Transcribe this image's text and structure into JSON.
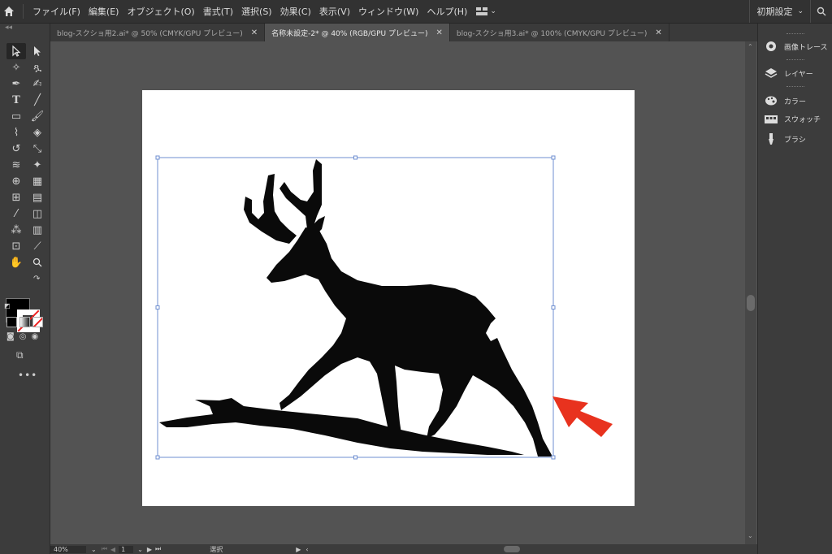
{
  "menu": {
    "items": [
      "ファイル(F)",
      "編集(E)",
      "オブジェクト(O)",
      "書式(T)",
      "選択(S)",
      "効果(C)",
      "表示(V)",
      "ウィンドウ(W)",
      "ヘルプ(H)"
    ],
    "workspace_preset": "初期設定"
  },
  "tabs": [
    {
      "label": "blog-スクショ用2.ai* @ 50% (CMYK/GPU プレビュー)",
      "active": false
    },
    {
      "label": "名称未設定-2* @ 40% (RGB/GPU プレビュー)",
      "active": true
    },
    {
      "label": "blog-スクショ用3.ai* @ 100% (CMYK/GPU プレビュー)",
      "active": false
    }
  ],
  "panels": {
    "items": [
      "画像トレース",
      "レイヤー",
      "カラー",
      "スウォッチ",
      "ブラシ"
    ]
  },
  "status": {
    "zoom": "40%",
    "artboard_number": "1",
    "tool": "選択"
  },
  "colors": {
    "accent_arrow": "#e8321e",
    "selection": "#6f8fd0"
  }
}
